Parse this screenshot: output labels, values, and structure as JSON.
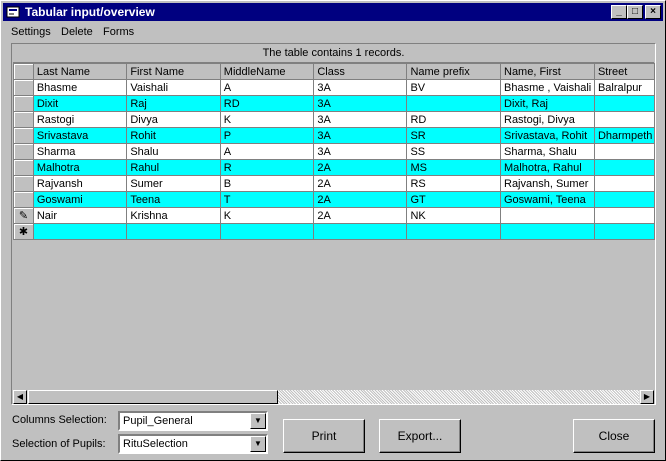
{
  "window": {
    "title": "Tabular input/overview"
  },
  "menu": {
    "settings": "Settings",
    "delete": "Delete",
    "forms": "Forms"
  },
  "grid": {
    "caption": "The table contains 1 records.",
    "columns": [
      "Last Name",
      "First Name",
      "MiddleName",
      "Class",
      "Name prefix",
      "Name, First",
      "Street"
    ],
    "rows": [
      [
        "Bhasme",
        "Vaishali",
        "A",
        "3A",
        "BV",
        "Bhasme , Vaishali",
        "Balralpur"
      ],
      [
        "Dixit",
        "Raj",
        "RD",
        "3A",
        "",
        "Dixit, Raj",
        ""
      ],
      [
        "Rastogi",
        "Divya",
        "K",
        "3A",
        "RD",
        "Rastogi, Divya",
        ""
      ],
      [
        "Srivastava",
        "Rohit",
        "P",
        "3A",
        "SR",
        "Srivastava, Rohit",
        "Dharmpeth"
      ],
      [
        "Sharma",
        "Shalu",
        "A",
        "3A",
        "SS",
        "Sharma, Shalu",
        ""
      ],
      [
        "Malhotra",
        "Rahul",
        "R",
        "2A",
        "MS",
        "Malhotra, Rahul",
        ""
      ],
      [
        "Rajvansh",
        "Sumer",
        "B",
        "2A",
        "RS",
        "Rajvansh, Sumer",
        ""
      ],
      [
        "Goswami",
        "Teena",
        "T",
        "2A",
        "GT",
        "Goswami, Teena",
        ""
      ],
      [
        "Nair",
        "Krishna",
        "K",
        "2A",
        "NK",
        "",
        ""
      ],
      [
        "",
        "",
        "",
        "",
        "",
        "",
        ""
      ]
    ],
    "editing_marker": "✎",
    "new_row_marker": "✱"
  },
  "columns_selection": {
    "label": "Columns Selection:",
    "value": "Pupil_General"
  },
  "pupils_selection": {
    "label": "Selection of Pupils:",
    "value": "RituSelection"
  },
  "buttons": {
    "print": "Print",
    "export": "Export...",
    "close": "Close"
  },
  "colors": {
    "title_bar": "#000080",
    "row_alt": "#00ffff",
    "row": "#ffffff",
    "face": "#c0c0c0"
  }
}
